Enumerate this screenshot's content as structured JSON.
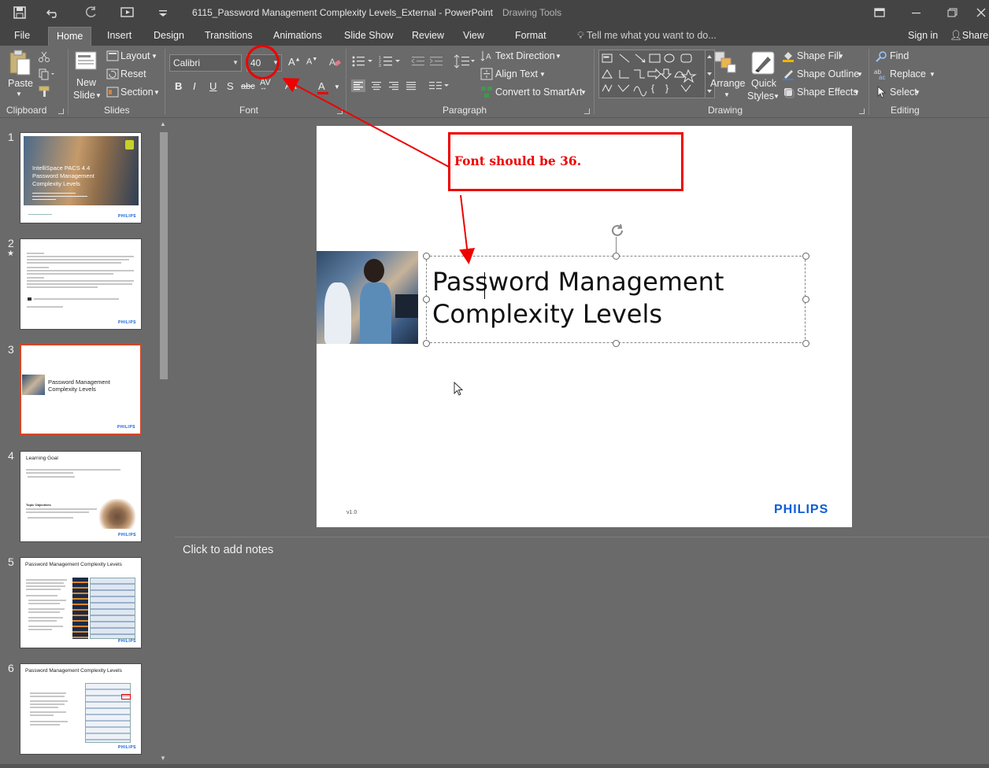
{
  "window": {
    "title": "6115_Password Management Complexity Levels_External - PowerPoint",
    "context_tab_title": "Drawing Tools"
  },
  "tabs": [
    {
      "label": "File"
    },
    {
      "label": "Home"
    },
    {
      "label": "Insert"
    },
    {
      "label": "Design"
    },
    {
      "label": "Transitions"
    },
    {
      "label": "Animations"
    },
    {
      "label": "Slide Show"
    },
    {
      "label": "Review"
    },
    {
      "label": "View"
    },
    {
      "label": "Format"
    }
  ],
  "tell_me": "Tell me what you want to do...",
  "account": {
    "sign_in": "Sign in",
    "share": "Share"
  },
  "ribbon": {
    "clipboard": {
      "label": "Clipboard",
      "paste": "Paste"
    },
    "slides": {
      "label": "Slides",
      "new_slide_1": "New",
      "new_slide_2": "Slide",
      "layout": "Layout",
      "reset": "Reset",
      "section": "Section"
    },
    "font": {
      "label": "Font",
      "font_name": "Calibri",
      "font_size": "40"
    },
    "paragraph": {
      "label": "Paragraph",
      "text_direction": "Text Direction",
      "align_text": "Align Text",
      "smartart": "Convert to SmartArt"
    },
    "drawing": {
      "label": "Drawing",
      "arrange": "Arrange",
      "quick_styles_1": "Quick",
      "quick_styles_2": "Styles",
      "shape_fill": "Shape Fill",
      "shape_outline": "Shape Outline",
      "shape_effects": "Shape Effects"
    },
    "editing": {
      "label": "Editing",
      "find": "Find",
      "replace": "Replace",
      "select": "Select"
    }
  },
  "thumbnails": [
    {
      "num": "1",
      "title_lines": [
        "IntelliSpace PACS 4.4",
        "Password Management",
        "Complexity Levels"
      ]
    },
    {
      "num": "2",
      "star": "★"
    },
    {
      "num": "3",
      "title_lines": [
        "Password Management",
        "Complexity Levels"
      ]
    },
    {
      "num": "4",
      "title": "Learning Goal",
      "sub": "Topic Objectives"
    },
    {
      "num": "5",
      "title": "Password Management Complexity Levels"
    },
    {
      "num": "6",
      "title": "Password Management Complexity Levels"
    }
  ],
  "slide": {
    "title_line1": "Password Management",
    "title_line2": "Complexity Levels",
    "version": "v1.0",
    "brand": "PHILIPS"
  },
  "annotation": {
    "text": "Font should be 36.",
    "color": "#e00000"
  },
  "notes_placeholder": "Click to add notes",
  "colors": {
    "accent_selected": "#d24726",
    "brand": "#0b5ed7"
  }
}
